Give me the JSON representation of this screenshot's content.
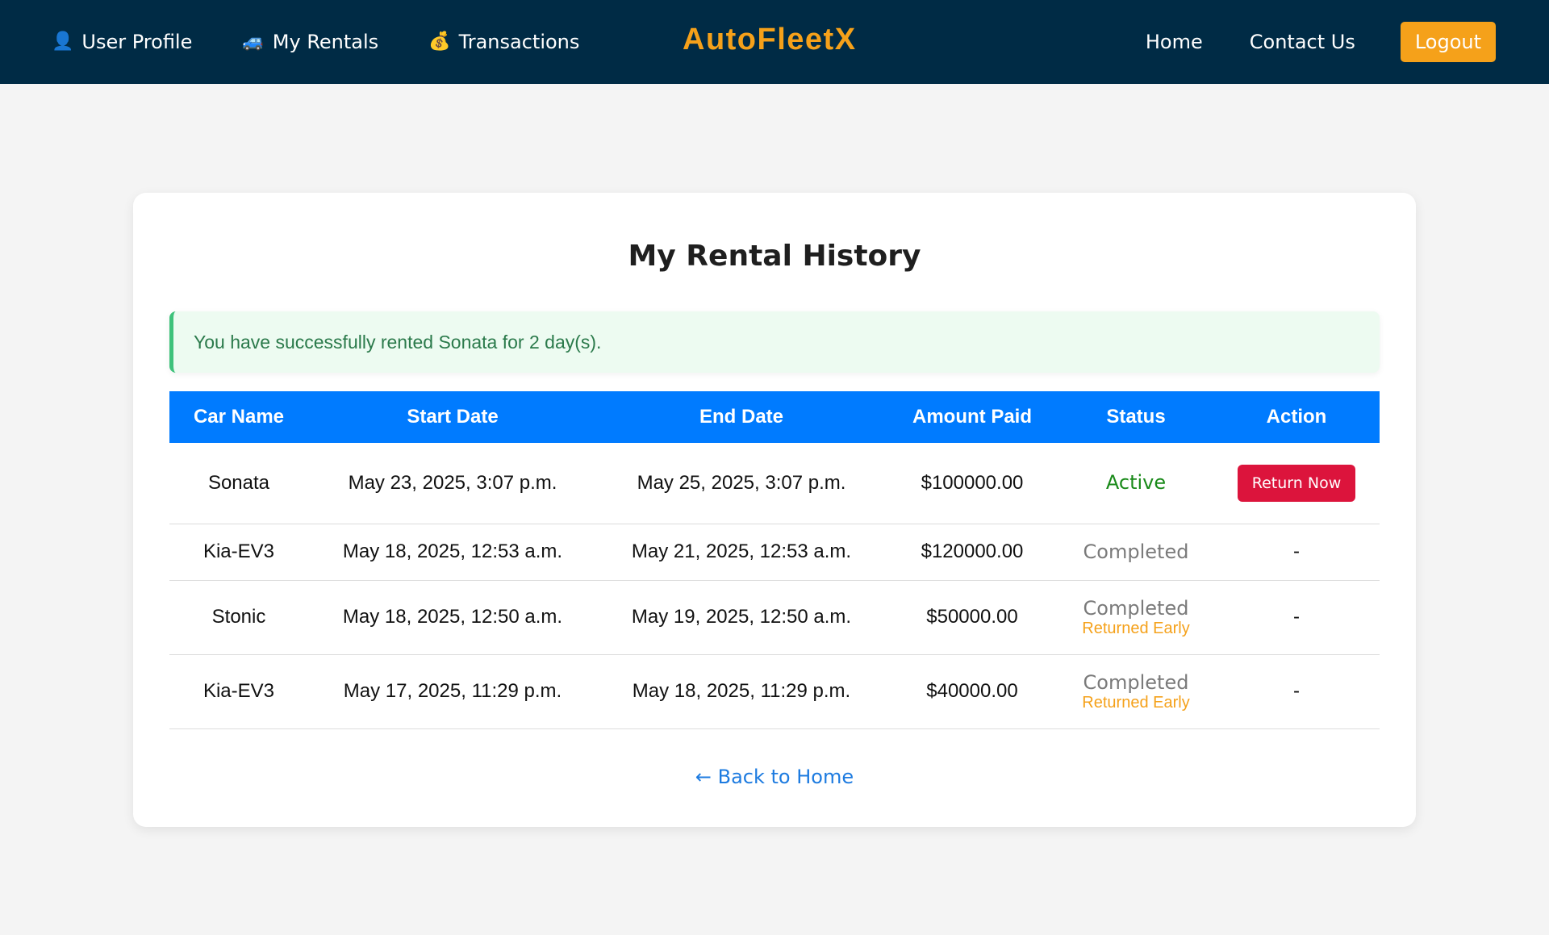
{
  "navbar": {
    "brand": "AutoFleetX",
    "left_links": [
      {
        "icon": "user-icon",
        "glyph": "👤",
        "label": "User Profile"
      },
      {
        "icon": "car-icon",
        "glyph": "🚙",
        "label": "My Rentals"
      },
      {
        "icon": "money-bag-icon",
        "glyph": "💰",
        "label": "Transactions"
      }
    ],
    "right_links": [
      "Home",
      "Contact Us"
    ],
    "logout_label": "Logout"
  },
  "page": {
    "title": "My Rental History",
    "alert_message": "You have successfully rented Sonata for 2 day(s).",
    "back_link": "← Back to Home"
  },
  "table": {
    "headers": [
      "Car Name",
      "Start Date",
      "End Date",
      "Amount Paid",
      "Status",
      "Action"
    ],
    "rows": [
      {
        "car": "Sonata",
        "start": "May 23, 2025, 3:07 p.m.",
        "end": "May 25, 2025, 3:07 p.m.",
        "amount": "$100000.00",
        "status": "Active",
        "status_note": "",
        "action": "Return Now"
      },
      {
        "car": "Kia-EV3",
        "start": "May 18, 2025, 12:53 a.m.",
        "end": "May 21, 2025, 12:53 a.m.",
        "amount": "$120000.00",
        "status": "Completed",
        "status_note": "",
        "action": "-"
      },
      {
        "car": "Stonic",
        "start": "May 18, 2025, 12:50 a.m.",
        "end": "May 19, 2025, 12:50 a.m.",
        "amount": "$50000.00",
        "status": "Completed",
        "status_note": "Returned Early",
        "action": "-"
      },
      {
        "car": "Kia-EV3",
        "start": "May 17, 2025, 11:29 p.m.",
        "end": "May 18, 2025, 11:29 p.m.",
        "amount": "$40000.00",
        "status": "Completed",
        "status_note": "Returned Early",
        "action": "-"
      }
    ]
  },
  "colors": {
    "navbar_bg": "#002b45",
    "brand": "#f5a11a",
    "table_header": "#007bff",
    "active": "#1a8a1a",
    "completed": "#7a7a7a",
    "early": "#f5a11a",
    "return_button": "#dc143c",
    "link": "#1d7be0"
  }
}
